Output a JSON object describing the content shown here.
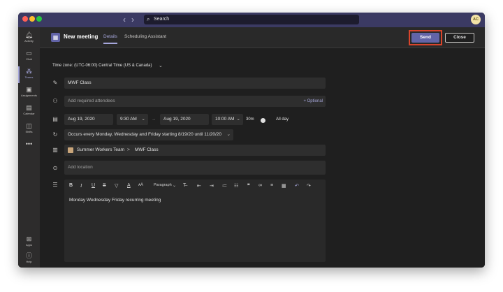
{
  "window": {
    "search_label": "Search",
    "avatar_initials": "AC"
  },
  "rail": {
    "items": [
      {
        "label": "Activity",
        "icon": "bell-icon"
      },
      {
        "label": "Chat",
        "icon": "chat-icon"
      },
      {
        "label": "Teams",
        "icon": "teams-icon",
        "active": true
      },
      {
        "label": "Assignments",
        "icon": "assignments-icon"
      },
      {
        "label": "Calendar",
        "icon": "calendar-icon"
      },
      {
        "label": "Shifts",
        "icon": "shifts-icon"
      },
      {
        "label": "",
        "icon": "more-icon"
      },
      {
        "label": "Apps",
        "icon": "apps-icon"
      },
      {
        "label": "Help",
        "icon": "help-icon"
      }
    ]
  },
  "header": {
    "title": "New meeting",
    "tabs": [
      {
        "label": "Details",
        "active": true
      },
      {
        "label": "Scheduling Assistant",
        "active": false
      }
    ],
    "send_label": "Send",
    "close_label": "Close"
  },
  "form": {
    "timezone": "Time zone: (UTC-06:00) Central Time (US & Canada)",
    "title_value": "MWF Class",
    "attendees_placeholder": "Add required attendees",
    "optional_label": "+ Optional",
    "start_date": "Aug 19, 2020",
    "start_time": "9:30 AM",
    "arrow": "→",
    "end_date": "Aug 19, 2020",
    "end_time": "10:00 AM",
    "duration": "30m",
    "all_day_label": "All day",
    "recurrence": "Occurs every Monday, Wednesday and Friday starting 8/19/20 until 11/20/20",
    "team_name": "Summer Workers Team",
    "breadcrumb_sep": ">",
    "channel_name": "MWF Class",
    "location_placeholder": "Add location",
    "paragraph_label": "Paragraph",
    "body_text": "Monday Wednesday Friday recurring meeting"
  },
  "colors": {
    "accent": "#6264a7",
    "send_highlight": "#d9442b",
    "titlebar": "#3b3a63"
  }
}
